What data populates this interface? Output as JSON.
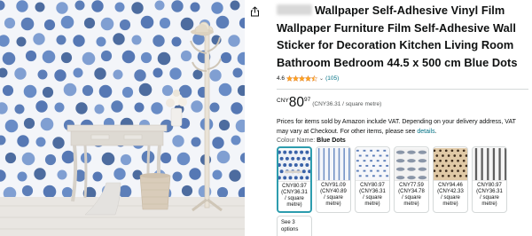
{
  "product": {
    "brand_blurred": "█████",
    "title": "Wallpaper Self-Adhesive Vinyl Film Wallpaper Furniture Film Self-Adhesive Wall Sticker for Decoration Kitchen Living Room Bathroom Bedroom 44.5 x 500 cm Blue Dots"
  },
  "rating": {
    "value": "4.6",
    "stars": 4.5,
    "chevron": "⌄",
    "reviews": "(105)"
  },
  "price": {
    "currency": "CNY",
    "whole": "80",
    "fraction": "97",
    "unit_price": "(CNY36.31 / square metre)"
  },
  "vat": {
    "text": "Prices for items sold by Amazon include VAT. Depending on your delivery address, VAT may vary at Checkout. For other items, please see ",
    "link": "details",
    "end": "."
  },
  "colour": {
    "label": "Colour Name:",
    "value": "Blue Dots"
  },
  "swatches": [
    {
      "price": "CNY80.97",
      "unit": "(CNY36.31",
      "per": "/ square",
      "metre": "metre)",
      "selected": true,
      "pattern": "blue-dots"
    },
    {
      "price": "CNY91.09",
      "unit": "(CNY40.89",
      "per": "/ square",
      "metre": "metre)",
      "selected": false,
      "pattern": "blue-stripes"
    },
    {
      "price": "CNY80.97",
      "unit": "(CNY36.31",
      "per": "/ square",
      "metre": "metre)",
      "selected": false,
      "pattern": "blue-dashes"
    },
    {
      "price": "CNY77.59",
      "unit": "(CNY34.78",
      "per": "/ square",
      "metre": "metre)",
      "selected": false,
      "pattern": "fish"
    },
    {
      "price": "CNY94.46",
      "unit": "(CNY42.33",
      "per": "/ square",
      "metre": "metre)",
      "selected": false,
      "pattern": "leopard"
    },
    {
      "price": "CNY80.97",
      "unit": "(CNY36.31",
      "per": "/ square",
      "metre": "metre)",
      "selected": false,
      "pattern": "grey-stripes"
    }
  ],
  "see_more": {
    "line1": "See 3",
    "line2": "options"
  },
  "icons": {
    "share": "share-icon"
  },
  "colors": {
    "link": "#007185",
    "star": "#ffa41c",
    "selected_border": "#2d9dae",
    "dot_blue": "#3a62a8"
  }
}
